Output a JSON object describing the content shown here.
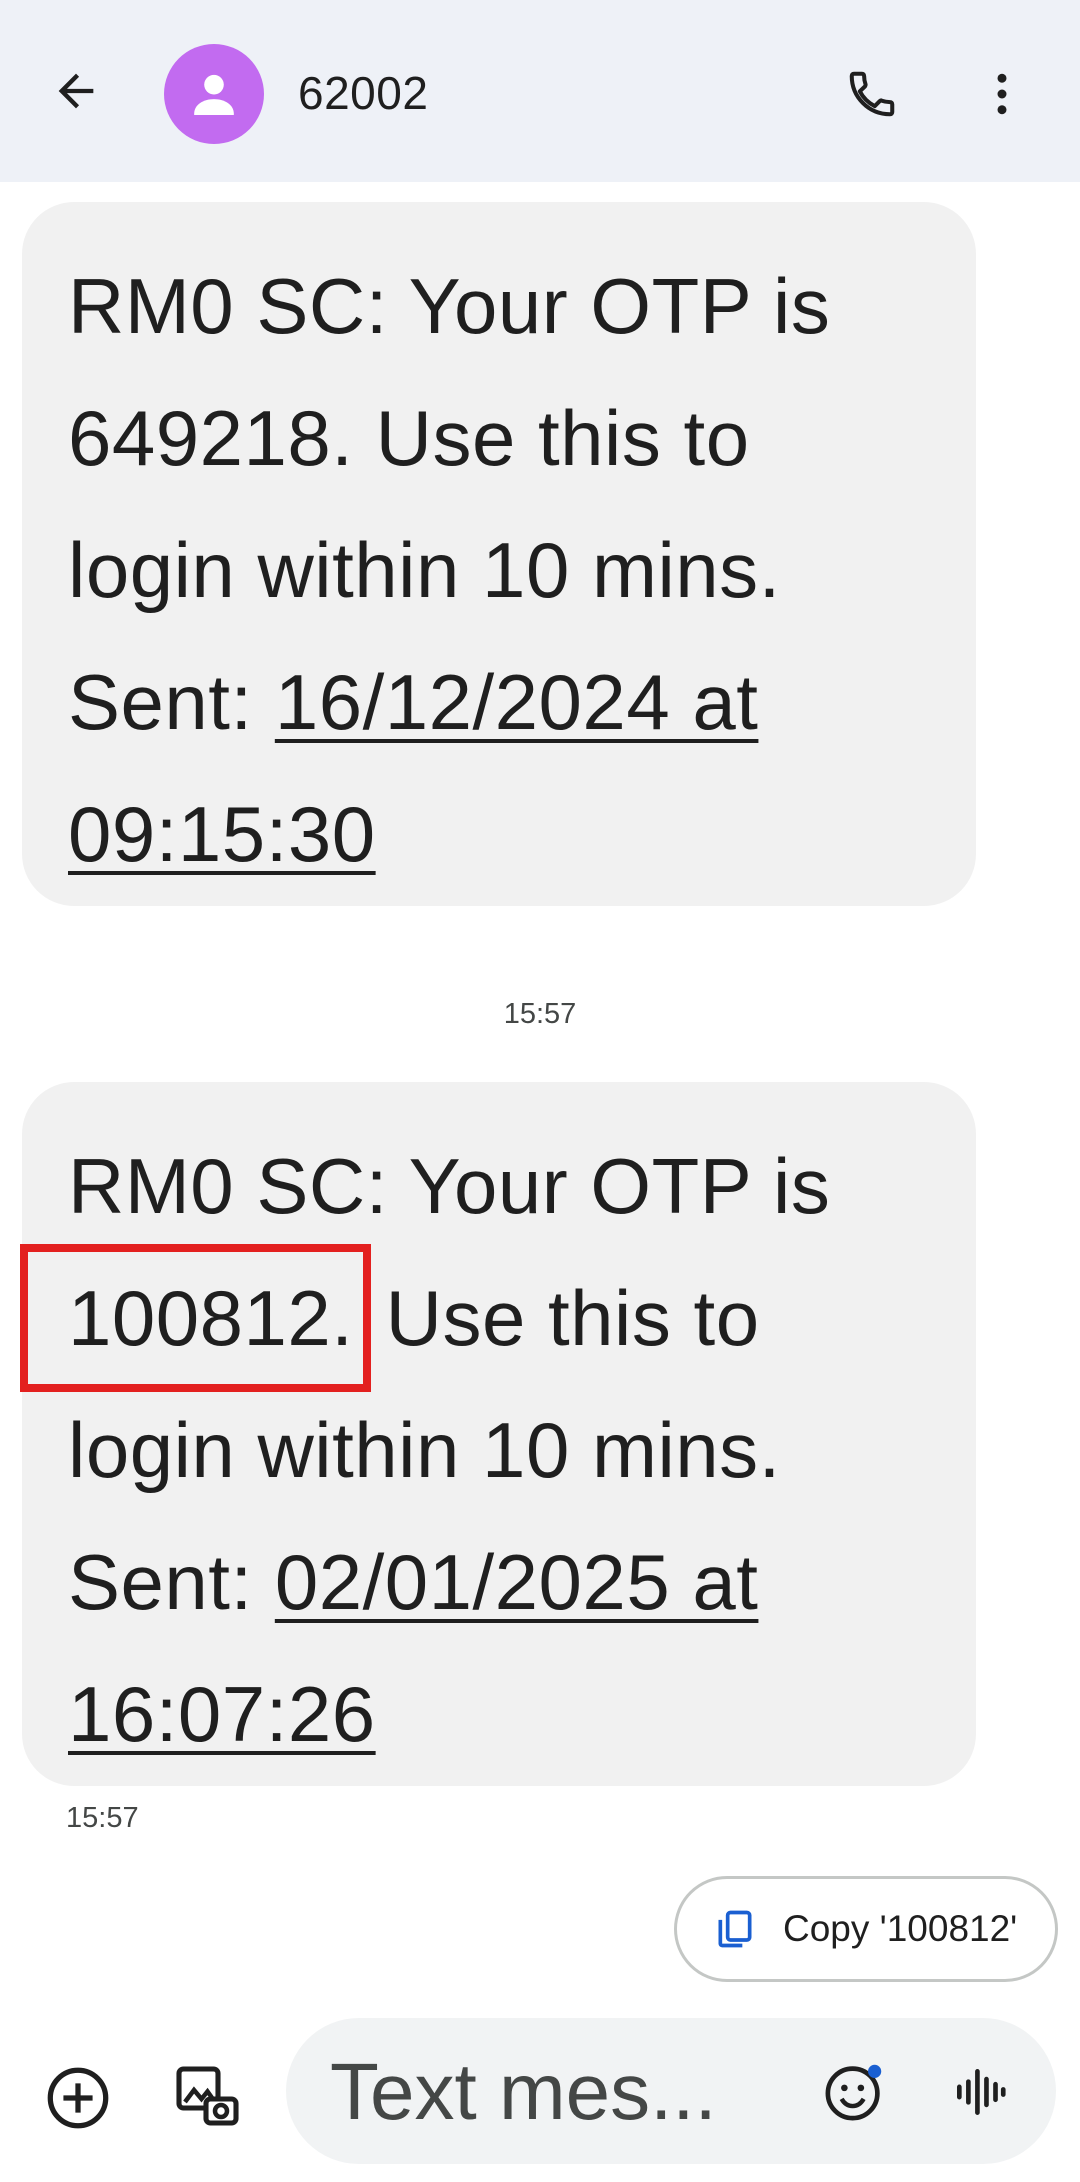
{
  "header": {
    "contact_name": "62002",
    "avatar_color": "#c26bf0",
    "icons": {
      "back": "arrow-back-icon",
      "call": "phone-icon",
      "more": "more-vertical-icon"
    }
  },
  "messages": [
    {
      "line1": "RM0 SC: Your OTP is",
      "otp": "649218.",
      "rest": " Use this to",
      "line3": "login within 10 mins.",
      "sent_label": "Sent: ",
      "sent_date": "16/12/2024 at",
      "sent_time": "09:15:30",
      "highlighted": false
    },
    {
      "line1": "RM0 SC: Your OTP is",
      "otp": "100812.",
      "rest": " Use this to",
      "line3": "login within 10 mins.",
      "sent_label": "Sent: ",
      "sent_date": "02/01/2025 at",
      "sent_time": "16:07:26",
      "highlighted": true
    }
  ],
  "timestamps": {
    "divider": "15:57",
    "last_message": "15:57"
  },
  "highlight_color": "#e3201f",
  "suggestion": {
    "copy_label": "Copy '100812'",
    "icon": "copy-icon"
  },
  "compose": {
    "placeholder": "Text mes...",
    "icons": {
      "add": "add-circle-icon",
      "gallery": "gallery-icon",
      "emoji": "emoji-icon",
      "voice": "voice-waveform-icon"
    }
  }
}
